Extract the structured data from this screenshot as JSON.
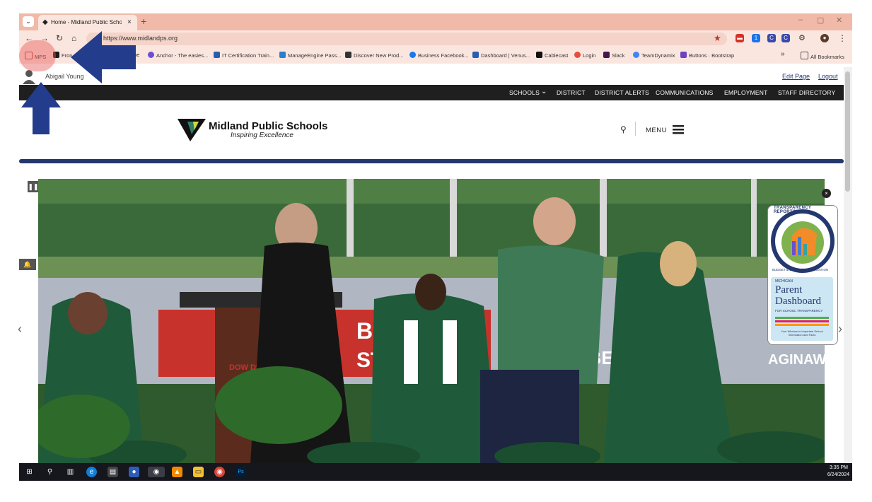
{
  "browser": {
    "tab_menu_icon": "chevron-down-icon",
    "tab_title": "Home - Midland Public Schools",
    "url": "https://www.midlandps.org",
    "bookmarks": [
      {
        "label": "MPS",
        "color": "#c0392b"
      },
      {
        "label": "Fron",
        "color": "#1a1a1a"
      },
      {
        "label": "me",
        "color": "#888888"
      },
      {
        "label": "Anchor - The easies...",
        "color": "#6a4fd6"
      },
      {
        "label": "IT Certification Train...",
        "color": "#2a5db0"
      },
      {
        "label": "ManageEngine Pass...",
        "color": "#2a7fd0"
      },
      {
        "label": "Discover New Prod...",
        "color": "#333333"
      },
      {
        "label": "Business Facebook...",
        "color": "#1877f2"
      },
      {
        "label": "Dashboard | Venus...",
        "color": "#2a5db0"
      },
      {
        "label": "Cablecast",
        "color": "#111111"
      },
      {
        "label": "Login",
        "color": "#e74c3c"
      },
      {
        "label": "Slack",
        "color": "#4a154b"
      },
      {
        "label": "TeamDynamix",
        "color": "#4285f4"
      },
      {
        "label": "Buttons · Bootstrap",
        "color": "#6f42c1"
      }
    ],
    "more_bookmarks": "»",
    "all_bookmarks": "All Bookmarks"
  },
  "userbar": {
    "user_name": "Abigail Young",
    "edit_page": "Edit Page",
    "logout": "Logout"
  },
  "nav": {
    "items": [
      "SCHOOLS",
      "DISTRICT",
      "DISTRICT ALERTS",
      "COMMUNICATIONS",
      "EMPLOYMENT",
      "STAFF DIRECTORY"
    ]
  },
  "logo": {
    "name": "Midland Public Schools",
    "tagline": "Inspiring Excellence"
  },
  "menu": {
    "label": "MENU"
  },
  "widget": {
    "ribbon": "TRANSPARENCY REPORTING",
    "sub_ribbon": "BUDGET & SALARY/COMPENSATION",
    "state": "MICHIGAN",
    "title_line1": "Parent",
    "title_line2": "Dashboard",
    "subtitle": "FOR SCHOOL TRANSPARENCY",
    "footer": "Your Window to Important School Information and Facts"
  },
  "hero": {
    "banner_text": "BOON",
    "banner_text2": "STAT",
    "sponsor": "DOW DIAMOND",
    "sign": "ARBE",
    "sign2": "AGINAW"
  },
  "taskbar": {
    "time": "3:35 PM",
    "date": "6/24/2024"
  },
  "colors": {
    "chrome": "#f0b9a8",
    "navy": "#24386f",
    "annotation_arrow": "#233c8c"
  }
}
